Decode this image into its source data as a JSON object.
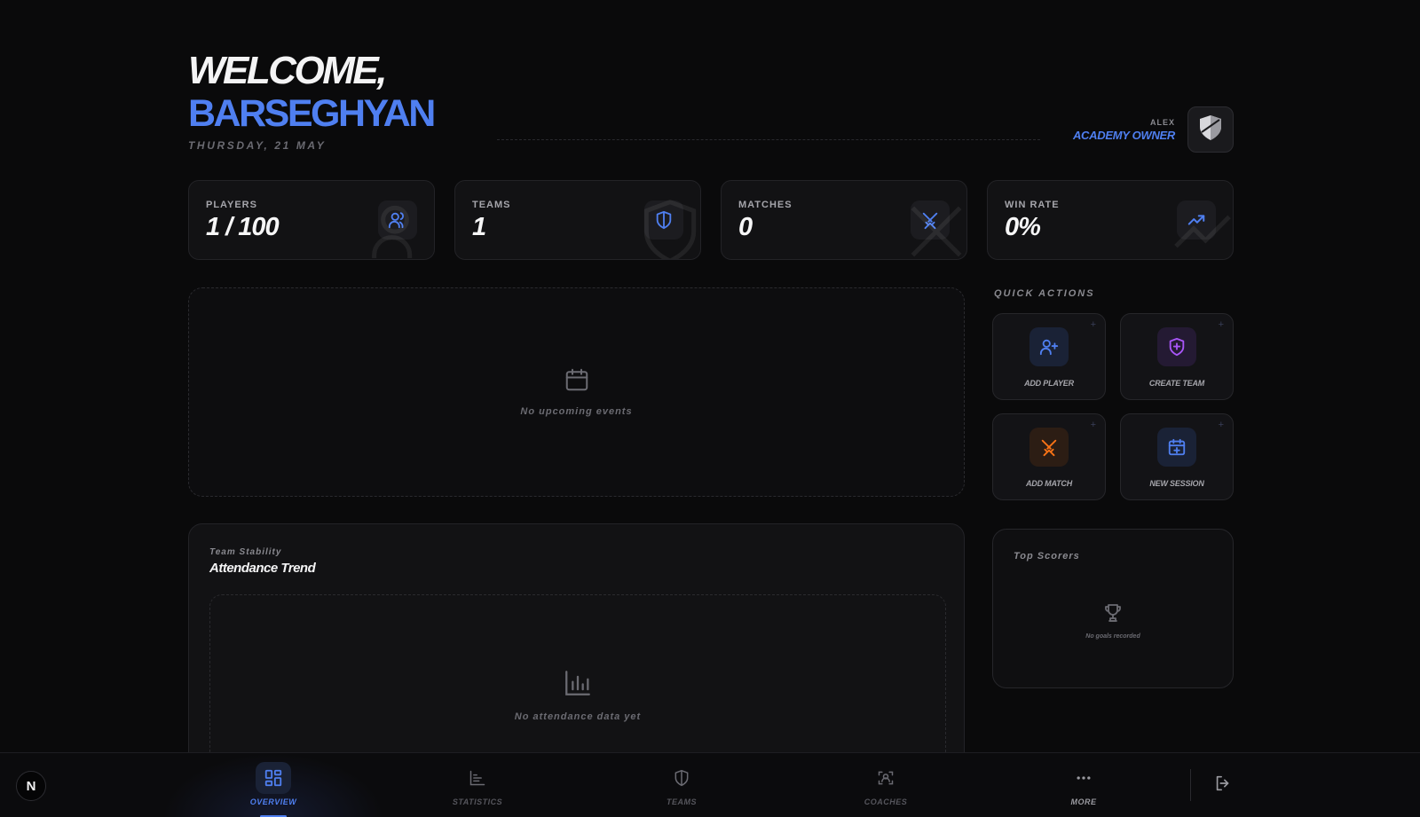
{
  "header": {
    "welcome": "WELCOME,",
    "name": "BARSEGHYAN",
    "date": "THURSDAY, 21 MAY"
  },
  "user": {
    "name": "ALEX",
    "role": "ACADEMY OWNER",
    "avatar_icon": "shield-crest-icon"
  },
  "stats": [
    {
      "label": "PLAYERS",
      "value": "1 / 100",
      "icon": "users-icon"
    },
    {
      "label": "TEAMS",
      "value": "1",
      "icon": "shield-icon"
    },
    {
      "label": "MATCHES",
      "value": "0",
      "icon": "swords-icon"
    },
    {
      "label": "WIN RATE",
      "value": "0%",
      "icon": "trending-up-icon"
    }
  ],
  "events": {
    "empty_text": "No upcoming events",
    "icon": "calendar-icon"
  },
  "quick_actions": {
    "title": "QUICK ACTIONS",
    "plus": "+",
    "items": [
      {
        "label": "ADD PLAYER",
        "icon": "user-plus-icon",
        "color": "#4f7ff0"
      },
      {
        "label": "CREATE TEAM",
        "icon": "shield-plus-icon",
        "color": "#a855f7"
      },
      {
        "label": "ADD MATCH",
        "icon": "swords-icon",
        "color": "#f97316"
      },
      {
        "label": "NEW SESSION",
        "icon": "calendar-plus-icon",
        "color": "#4f7ff0"
      }
    ]
  },
  "attendance": {
    "kicker": "Team Stability",
    "title": "Attendance Trend",
    "empty_text": "No attendance data yet",
    "icon": "bar-chart-icon"
  },
  "top_scorers": {
    "title": "Top Scorers",
    "empty_text": "No goals recorded",
    "icon": "trophy-icon"
  },
  "nav": {
    "logo": "N",
    "items": [
      {
        "label": "OVERVIEW",
        "icon": "dashboard-icon",
        "active": true
      },
      {
        "label": "STATISTICS",
        "icon": "chart-icon",
        "active": false
      },
      {
        "label": "TEAMS",
        "icon": "shield-icon",
        "active": false
      },
      {
        "label": "COACHES",
        "icon": "coach-scan-icon",
        "active": false
      },
      {
        "label": "MORE",
        "icon": "more-dots-icon",
        "active": false
      }
    ],
    "logout_icon": "logout-icon"
  },
  "colors": {
    "accent": "#4f7ff0",
    "background": "#0a0a0b",
    "card": "#121214"
  }
}
